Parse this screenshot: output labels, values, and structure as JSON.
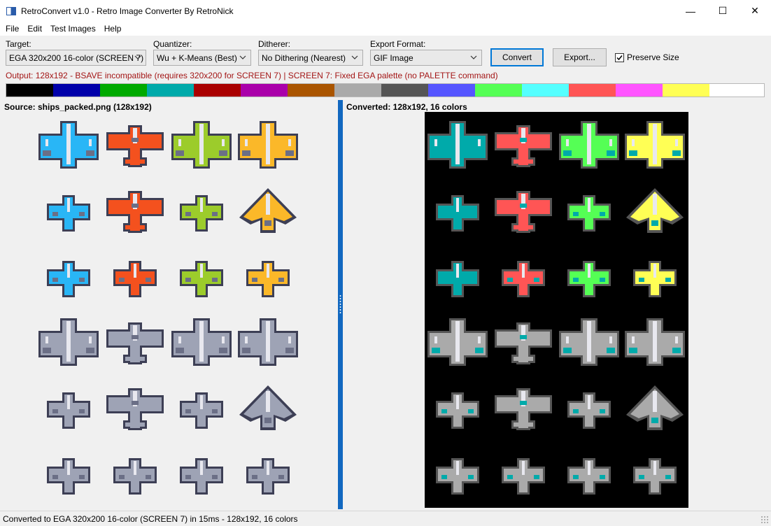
{
  "window": {
    "title": "RetroConvert v1.0 - Retro Image Converter By RetroNick",
    "minimize_glyph": "—",
    "maximize_glyph": "☐",
    "close_glyph": "✕"
  },
  "menu": [
    "File",
    "Edit",
    "Test Images",
    "Help"
  ],
  "controls": {
    "target_label": "Target:",
    "target_value": "EGA 320x200 16-color (SCREEN 7)",
    "quantizer_label": "Quantizer:",
    "quantizer_value": "Wu + K-Means (Best)",
    "ditherer_label": "Ditherer:",
    "ditherer_value": "No Dithering (Nearest)",
    "export_label": "Export Format:",
    "export_value": "GIF Image",
    "convert_button": "Convert",
    "export_button": "Export...",
    "preserve_size_label": "Preserve Size",
    "preserve_size_checked": true
  },
  "output_info": "Output: 128x192 - BSAVE incompatible (requires 320x200 for SCREEN 7)  |  SCREEN 7: Fixed EGA palette (no PALETTE command)",
  "palette": [
    "#000000",
    "#0000aa",
    "#00aa00",
    "#00aaaa",
    "#aa0000",
    "#aa00aa",
    "#aa5500",
    "#aaaaaa",
    "#555555",
    "#5555ff",
    "#55ff55",
    "#55ffff",
    "#ff5555",
    "#ff55ff",
    "#ffff55",
    "#ffffff"
  ],
  "source_panel": {
    "title": "Source: ships_packed.png (128x192)",
    "ship_colors": [
      [
        "#29b6f6",
        "#f4511e",
        "#9ccc2b",
        "#fbb829"
      ],
      [
        "#29b6f6",
        "#f4511e",
        "#9ccc2b",
        "#fbb829"
      ],
      [
        "#29b6f6",
        "#f4511e",
        "#9ccc2b",
        "#fbb829"
      ],
      [
        "#9ea3b5",
        "#9ea3b5",
        "#9ea3b5",
        "#9ea3b5"
      ],
      [
        "#9ea3b5",
        "#9ea3b5",
        "#9ea3b5",
        "#9ea3b5"
      ],
      [
        "#9ea3b5",
        "#9ea3b5",
        "#9ea3b5",
        "#9ea3b5"
      ]
    ]
  },
  "converted_panel": {
    "title": "Converted: 128x192, 16 colors",
    "ship_colors": [
      [
        "#00aaaa",
        "#ff5555",
        "#55ff55",
        "#ffff55"
      ],
      [
        "#00aaaa",
        "#ff5555",
        "#55ff55",
        "#ffff55"
      ],
      [
        "#00aaaa",
        "#ff5555",
        "#55ff55",
        "#ffff55"
      ],
      [
        "#aaaaaa",
        "#aaaaaa",
        "#aaaaaa",
        "#aaaaaa"
      ],
      [
        "#aaaaaa",
        "#aaaaaa",
        "#aaaaaa",
        "#aaaaaa"
      ],
      [
        "#aaaaaa",
        "#aaaaaa",
        "#aaaaaa",
        "#aaaaaa"
      ]
    ]
  },
  "status": "Converted to EGA 320x200 16-color (SCREEN 7) in 15ms - 128x192, 16 colors"
}
